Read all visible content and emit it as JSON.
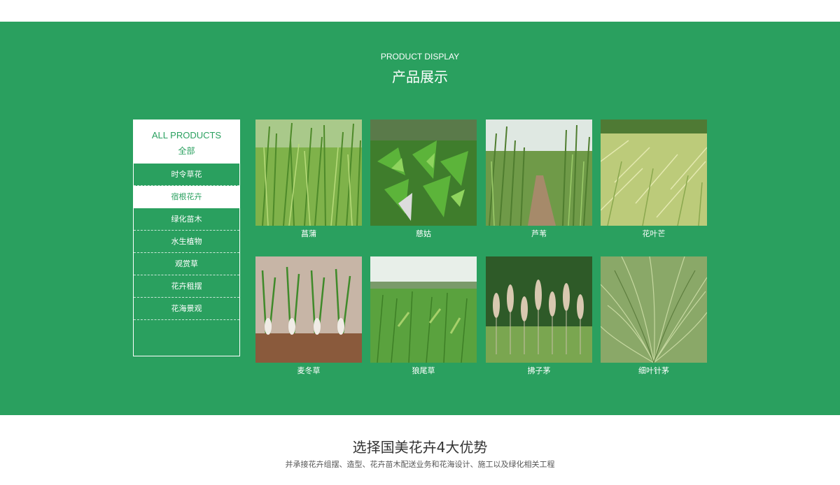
{
  "product_section": {
    "title_en": "PRODUCT DISPLAY",
    "title_cn": "产品展示"
  },
  "sidebar": {
    "header_en": "ALL PRODUCTS",
    "header_cn": "全部",
    "items": [
      {
        "label": "时令草花"
      },
      {
        "label": "宿根花卉",
        "active": true
      },
      {
        "label": "绿化苗木"
      },
      {
        "label": "水生植物"
      },
      {
        "label": "观赏草"
      },
      {
        "label": "花卉租摆"
      },
      {
        "label": "花海景观"
      }
    ]
  },
  "products": [
    {
      "name": "菖蒲",
      "image": "tall-grass-photo"
    },
    {
      "name": "慈姑",
      "image": "arrowhead-leaves-photo"
    },
    {
      "name": "芦苇",
      "image": "reed-path-photo"
    },
    {
      "name": "花叶芒",
      "image": "variegated-grass-photo"
    },
    {
      "name": "麦冬草",
      "image": "root-seedlings-photo"
    },
    {
      "name": "狼尾草",
      "image": "foxtail-grass-photo"
    },
    {
      "name": "拂子茅",
      "image": "plume-grass-photo"
    },
    {
      "name": "细叶针茅",
      "image": "feather-grass-photo"
    }
  ],
  "advantages": {
    "title": "选择国美花卉4大优势",
    "subtitle": "并承接花卉组摆、造型、花卉苗木配送业务和花海设计、施工以及绿化相关工程"
  },
  "colors": {
    "brand_green": "#2aa05f",
    "white": "#ffffff"
  }
}
